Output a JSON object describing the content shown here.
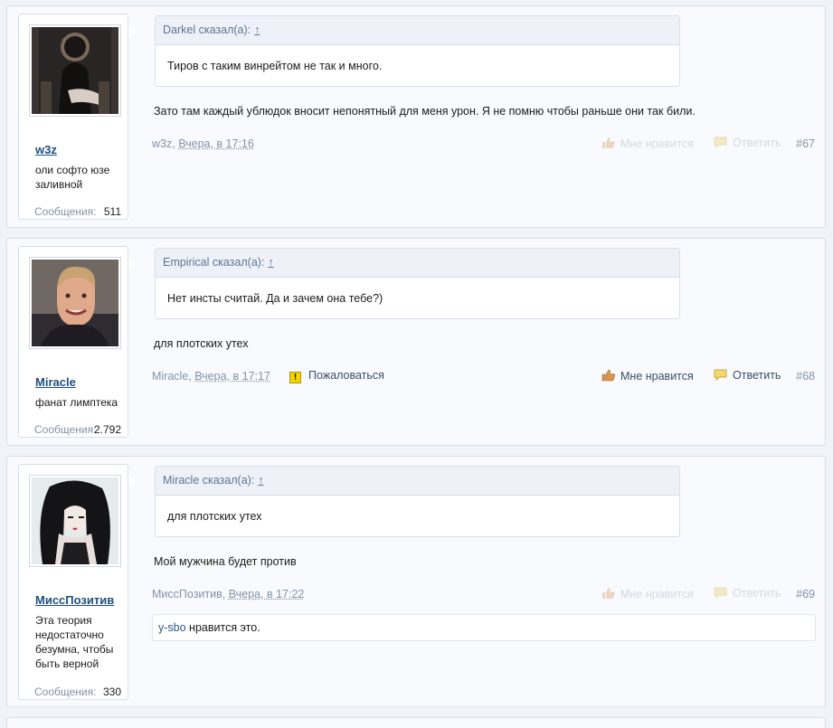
{
  "posts": [
    {
      "username": "w3z",
      "user_title": "оли софто юзе заливной",
      "messages_label": "Сообщения:",
      "messages_count": "511",
      "quote_author": "Darkel сказал(а):",
      "quote_up": "↑",
      "quote_text": "Тиров с таким винрейтом не так и много.",
      "text": "Зато там каждый ублюдок вносит непонятный для меня урон. Я не помню чтобы раньше они так били.",
      "meta_author": "w3z,",
      "meta_date": "Вчера, в 17:16",
      "like_label": "Мне нравится",
      "reply_label": "Ответить",
      "post_number": "#67"
    },
    {
      "username": "Miracle",
      "user_title": "фанат лимптека",
      "messages_label": "Сообщения:",
      "messages_count": "2.792",
      "quote_author": "Empirical сказал(а):",
      "quote_up": "↑",
      "quote_text": "Нет инсты считай. Да и зачем она тебе?)",
      "text": "для плотских утех",
      "meta_author": "Miracle,",
      "meta_date": "Вчера, в 17:17",
      "report_icon": "!",
      "report_label": "Пожаловаться",
      "like_label": "Мне нравится",
      "reply_label": "Ответить",
      "post_number": "#68"
    },
    {
      "username": "МиссПозитив",
      "user_title": "Эта теория недостаточно безумна, чтобы быть верной",
      "messages_label": "Сообщения:",
      "messages_count": "330",
      "quote_author": "Miracle сказал(а):",
      "quote_up": "↑",
      "quote_text": "для плотских утех",
      "text": "Мой мужчина будет против",
      "meta_author": "МиссПозитив,",
      "meta_date": "Вчера, в 17:22",
      "like_label": "Мне нравится",
      "reply_label": "Ответить",
      "post_number": "#69",
      "likes_user": "y-sbo",
      "likes_text": " нравится это."
    }
  ],
  "colors": {
    "background": "#f0f3f8",
    "post_bg": "#f9fafd",
    "border": "#d7dfea",
    "username": "#1f4f7f",
    "meta": "#8392a7",
    "faded_action": "#d4d9e1"
  },
  "icons": {
    "like": "thumbs-up-icon",
    "reply": "speech-bubble-icon",
    "report": "warning-icon"
  }
}
